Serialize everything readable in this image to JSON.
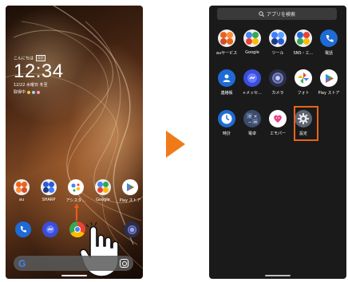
{
  "home": {
    "greeting": "こんにちは",
    "greeting_badge": "設定",
    "time": "12:34",
    "date": "12/22 水曜日 冬至",
    "info": "取得中",
    "dock_apps": [
      {
        "label": "au",
        "icon": "au-folder-icon"
      },
      {
        "label": "SHARP",
        "icon": "sharp-folder-icon"
      },
      {
        "label": "アシスタ…",
        "icon": "google-assistant-icon"
      },
      {
        "label": "Google",
        "icon": "google-folder-icon"
      },
      {
        "label": "Play ストア",
        "icon": "play-store-icon"
      }
    ],
    "bottom_apps": [
      "phone-icon",
      "messenger-icon",
      "chrome-icon",
      "camera-icon"
    ],
    "search_logo": "G"
  },
  "drawer": {
    "search_placeholder": "アプリを検索",
    "rows": [
      [
        {
          "label": "auサービス",
          "icon": "au-services-folder-icon"
        },
        {
          "label": "Google",
          "icon": "google-folder-icon"
        },
        {
          "label": "ツール",
          "icon": "tools-folder-icon"
        },
        {
          "label": "SNS・エ…",
          "icon": "sns-folder-icon"
        },
        {
          "label": "電話",
          "icon": "phone-icon"
        }
      ],
      [
        {
          "label": "連絡帳",
          "icon": "contacts-icon"
        },
        {
          "label": "+メッセ…",
          "icon": "plus-message-icon"
        },
        {
          "label": "カメラ",
          "icon": "camera-icon"
        },
        {
          "label": "フォト",
          "icon": "photos-icon"
        },
        {
          "label": "Play ストア",
          "icon": "play-store-icon"
        }
      ],
      [
        {
          "label": "時計",
          "icon": "clock-icon"
        },
        {
          "label": "電卓",
          "icon": "calculator-icon"
        },
        {
          "label": "エモパー",
          "icon": "emopa-icon"
        },
        {
          "label": "設定",
          "icon": "settings-icon"
        }
      ]
    ]
  },
  "colors": {
    "accent": "#f07a1a",
    "highlight": "#e8641a",
    "drawer_bg": "#1a1a1a",
    "blue_icon": "#1f6bd6"
  }
}
